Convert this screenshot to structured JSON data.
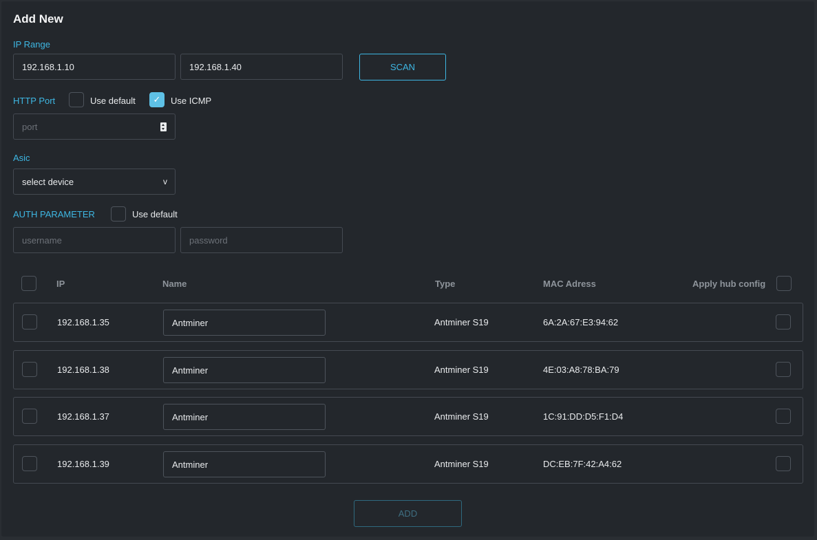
{
  "title": "Add New",
  "ip_range": {
    "label": "IP Range",
    "start": "192.168.1.10",
    "end": "192.168.1.40",
    "scan_label": "SCAN"
  },
  "http_port": {
    "label": "HTTP Port",
    "use_default_label": "Use default",
    "use_default": false,
    "use_icmp_label": "Use ICMP",
    "use_icmp": true,
    "placeholder": "port"
  },
  "asic": {
    "label": "Asic",
    "selected": "select device",
    "caret": "v"
  },
  "auth": {
    "label": "AUTH PARAMETER",
    "use_default_label": "Use default",
    "use_default": false,
    "username_placeholder": "username",
    "password_placeholder": "password"
  },
  "table": {
    "headers": {
      "ip": "IP",
      "name": "Name",
      "type": "Type",
      "mac": "MAC Adress",
      "apply": "Apply hub config"
    },
    "rows": [
      {
        "ip": "192.168.1.35",
        "name": "Antminer",
        "type": "Antminer S19",
        "mac": "6A:2A:67:E3:94:62",
        "selected": false,
        "apply": false
      },
      {
        "ip": "192.168.1.38",
        "name": "Antminer",
        "type": "Antminer S19",
        "mac": "4E:03:A8:78:BA:79",
        "selected": false,
        "apply": false
      },
      {
        "ip": "192.168.1.37",
        "name": "Antminer",
        "type": "Antminer S19",
        "mac": "1C:91:DD:D5:F1:D4",
        "selected": false,
        "apply": false
      },
      {
        "ip": "192.168.1.39",
        "name": "Antminer",
        "type": "Antminer S19",
        "mac": "DC:EB:7F:42:A4:62",
        "selected": false,
        "apply": false
      }
    ]
  },
  "add_label": "ADD",
  "colors": {
    "accent": "#3eb7e3",
    "background": "#23272c",
    "border": "#454a52"
  }
}
